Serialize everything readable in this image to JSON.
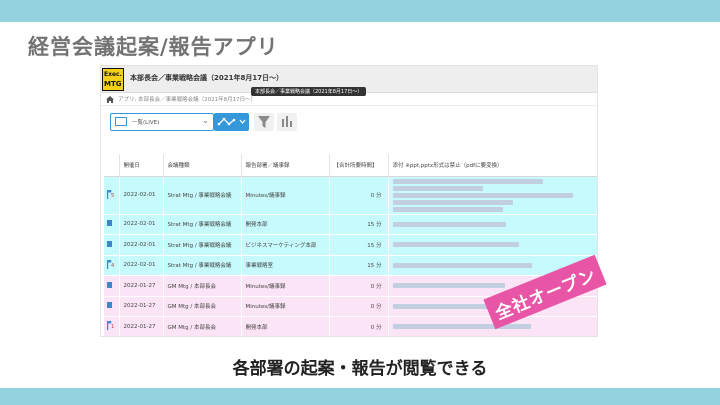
{
  "slide": {
    "title": "経営会議起案/報告アプリ",
    "caption": "各部署の起案・報告が閲覧できる",
    "stamp": "全社オープン",
    "band_color": "#94d2df",
    "stamp_color": "#e955a6"
  },
  "app": {
    "logo_line1": "Exec.",
    "logo_line2": "MTG",
    "title": "本部長会／事業戦略会議（2021年8月17日～）",
    "tooltip": "本部長会／事業戦略会議（2021年8月17日～）",
    "breadcrumb": "アプリ: 本部長会／事業戦略会議（2021年8月17日～）",
    "view_select": "一覧(LIVE)",
    "accent_color": "#3498db",
    "table": {
      "headers": [
        "開催日",
        "会議種類",
        "報告部署／議事録",
        "【合計所要時間】",
        "添付 ※ppt,pptx形式は禁止（pdfに要変換）"
      ],
      "rows": [
        {
          "icon": "flag-icon",
          "badge": "5",
          "date": "2022-02-01",
          "meeting": "Strat Mtg / 事業戦略会議",
          "dept": "Minutes/議事録",
          "time": "0 分",
          "color": "cyan",
          "tall": true
        },
        {
          "icon": "doc-icon",
          "badge": "",
          "date": "2022-02-01",
          "meeting": "Strat Mtg / 事業戦略会議",
          "dept": "開発本部",
          "time": "15 分",
          "color": "cyan",
          "tall": false
        },
        {
          "icon": "doc-icon",
          "badge": "",
          "date": "2022-02-01",
          "meeting": "Strat Mtg / 事業戦略会議",
          "dept": "ビジネスマーケティング本部",
          "time": "15 分",
          "color": "cyan",
          "tall": false
        },
        {
          "icon": "flag-icon",
          "badge": "4",
          "date": "2022-02-01",
          "meeting": "Strat Mtg / 事業戦略会議",
          "dept": "事業戦略室",
          "time": "15 分",
          "color": "cyan",
          "tall": false
        },
        {
          "icon": "doc-icon",
          "badge": "",
          "date": "2022-01-27",
          "meeting": "GM Mtg / 本部長会",
          "dept": "Minutes/議事録",
          "time": "0 分",
          "color": "pink",
          "tall": false
        },
        {
          "icon": "doc-icon",
          "badge": "",
          "date": "2022-01-27",
          "meeting": "GM Mtg / 本部長会",
          "dept": "Minutes/議事録",
          "time": "0 分",
          "color": "pink",
          "tall": false
        },
        {
          "icon": "flag-icon",
          "badge": "1",
          "date": "2022-01-27",
          "meeting": "GM Mtg / 本部長会",
          "dept": "開発本部",
          "time": "0 分",
          "color": "pink",
          "tall": false
        }
      ]
    }
  }
}
